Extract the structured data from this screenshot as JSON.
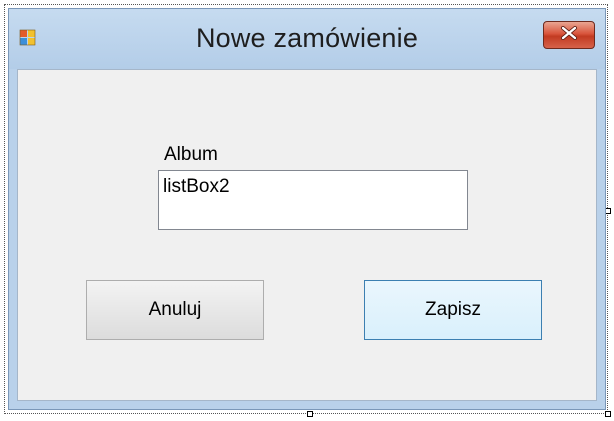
{
  "window": {
    "title": "Nowe zamówienie",
    "icon": "app-form-icon",
    "close_icon": "close-icon"
  },
  "form": {
    "album_label": "Album",
    "album_listbox": {
      "items": [
        "listBox2"
      ]
    },
    "cancel_label": "Anuluj",
    "save_label": "Zapisz"
  },
  "colors": {
    "titlebar": "#b9d1ea",
    "client_background": "#f0f0f0",
    "close_button": "#c7452c",
    "default_button_border": "#3c7fb1"
  }
}
